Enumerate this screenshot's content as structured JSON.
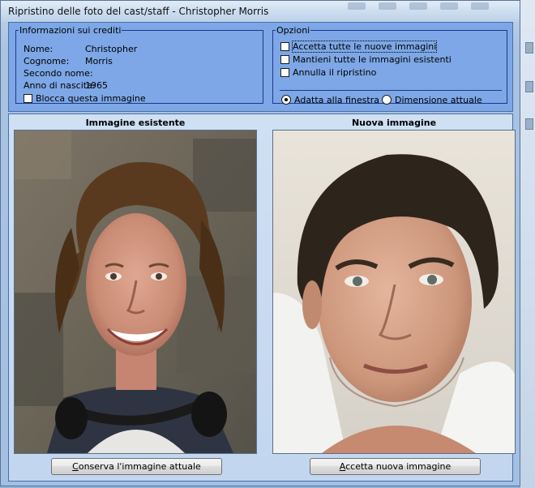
{
  "window": {
    "title": "Ripristino delle foto del cast/staff - Christopher Morris"
  },
  "credits": {
    "legend": "Informazioni sui crediti",
    "fields": [
      {
        "label": "Nome:",
        "value": "Christopher"
      },
      {
        "label": "Cognome:",
        "value": "Morris"
      },
      {
        "label": "Secondo nome:",
        "value": ""
      },
      {
        "label": "Anno di nascita:",
        "value": "1965"
      }
    ],
    "lock_image_label": "Blocca questa immagine",
    "lock_image_checked": false
  },
  "options": {
    "legend": "Opzioni",
    "checkboxes": [
      {
        "label": "Accetta tutte le nuove immagini",
        "checked": false
      },
      {
        "label": "Mantieni tutte le immagini esistenti",
        "checked": false
      },
      {
        "label": "Annulla il ripristino",
        "checked": false
      }
    ],
    "radios": [
      {
        "label": "Adatta alla finestra",
        "selected": true
      },
      {
        "label": "Dimensione attuale",
        "selected": false
      }
    ]
  },
  "existing": {
    "heading": "Immagine esistente",
    "button_prefix": "",
    "button_hotkey": "C",
    "button_rest": "onserva l'immagine attuale"
  },
  "new_image": {
    "heading": "Nuova immagine",
    "button_hotkey": "A",
    "button_rest": "ccetta nuova immagine"
  }
}
